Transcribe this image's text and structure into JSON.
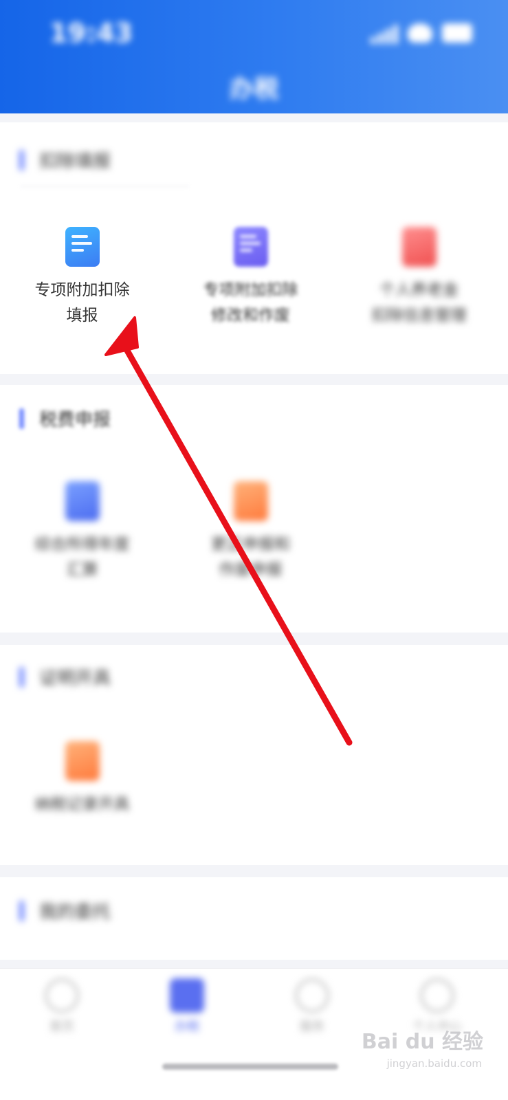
{
  "status_bar": {
    "time": "19:43"
  },
  "header": {
    "title": "办税"
  },
  "sections": [
    {
      "title": "扣除填报"
    },
    {
      "title": "税费申报"
    },
    {
      "title": "证明开具"
    },
    {
      "title": "我的委托"
    }
  ],
  "deduction_items": [
    {
      "line1": "专项附加扣除",
      "line2": "填报",
      "icon": "deduction-form-icon"
    },
    {
      "line1": "专项附加扣除",
      "line2": "修改和作废",
      "icon": "deduction-modify-icon"
    },
    {
      "line1": "个人养老金",
      "line2": "扣除信息管理",
      "icon": "pension-icon"
    }
  ],
  "tax_items": [
    {
      "line1": "综合所得年度",
      "line2": "汇算",
      "icon": "annual-settlement-icon"
    },
    {
      "line1": "更正申报和",
      "line2": "作废申报",
      "icon": "correction-icon"
    }
  ],
  "certificate_items": [
    {
      "line1": "纳税记录开具",
      "icon": "tax-record-icon"
    }
  ],
  "bottom_nav": [
    {
      "label": "首页",
      "icon": "home-icon"
    },
    {
      "label": "办税",
      "icon": "tax-icon",
      "active": true
    },
    {
      "label": "服务",
      "icon": "service-icon"
    },
    {
      "label": "个人中心",
      "icon": "user-icon"
    }
  ],
  "watermark": {
    "brand": "Bai du 经验",
    "url": "jingyan.baidu.com"
  },
  "colors": {
    "header_start": "#1565e8",
    "header_end": "#4a8ff2",
    "accent": "#6f86ff",
    "arrow": "#e8101a"
  }
}
